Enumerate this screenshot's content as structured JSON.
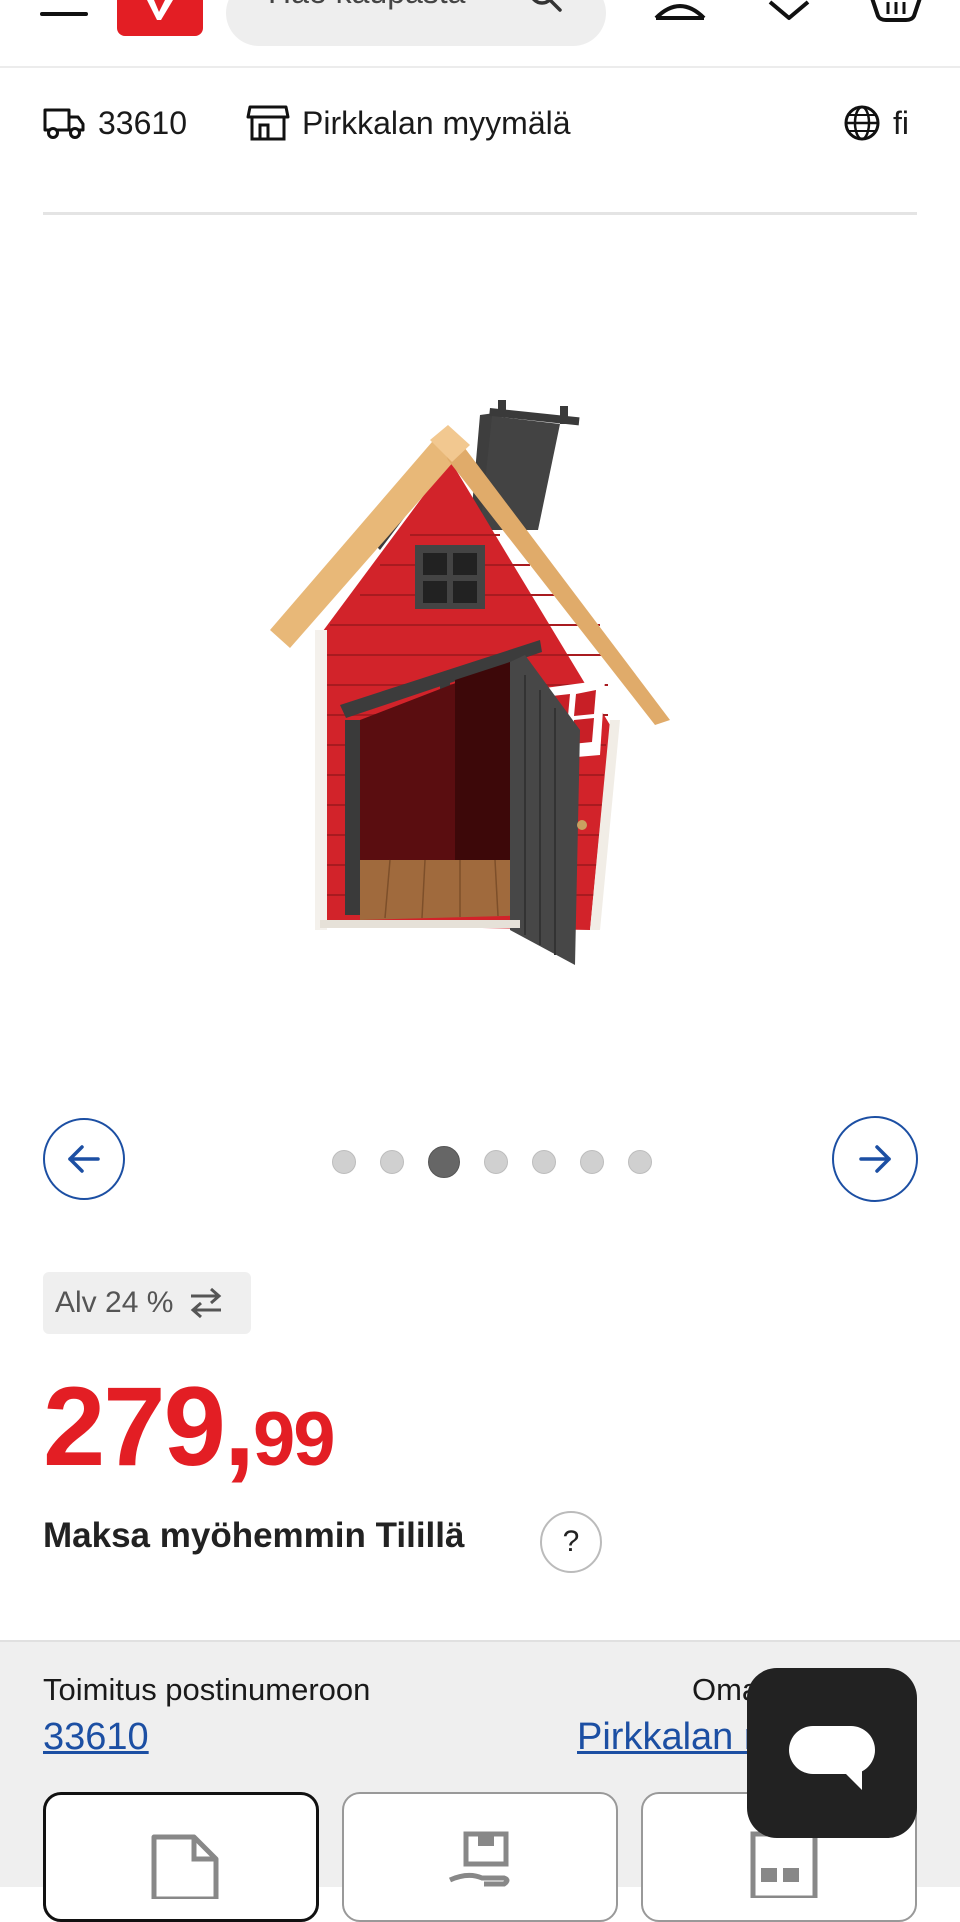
{
  "header": {
    "search_placeholder": "Hae kaupasta",
    "icons": [
      "menu-icon",
      "logo",
      "search-icon",
      "account-icon",
      "favorites-icon",
      "basket-icon"
    ]
  },
  "infobar": {
    "postcode": "33610",
    "store": "Pirkkalan myymälä",
    "language": "fi"
  },
  "gallery": {
    "image_alt": "Red wooden playhouse with dark grey door and chimney",
    "dots_count": 7,
    "active_index": 2
  },
  "product": {
    "vat_label": "Alv 24 %",
    "price_int": "279,",
    "price_dec": "99",
    "pay_later": "Maksa myöhemmin Tilillä",
    "help": "?"
  },
  "delivery": {
    "left_label": "Toimitus postinumeroon",
    "left_value": "33610",
    "right_label": "Oma myymälä",
    "right_value": "Pirkkalan myymälä"
  },
  "colors": {
    "brand_red": "#e31e24",
    "link_blue": "#1c4fa3"
  }
}
